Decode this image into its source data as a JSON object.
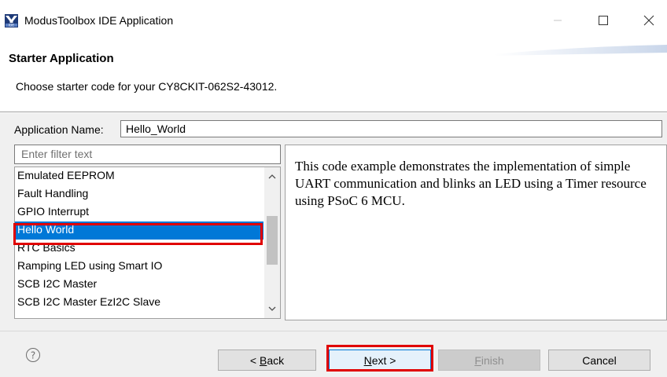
{
  "window": {
    "title": "ModusToolbox IDE Application",
    "icon": "ide-app-icon",
    "controls": [
      "minimize-icon",
      "maximize-icon",
      "close-icon"
    ]
  },
  "header": {
    "title": "Starter Application",
    "subtitle": "Choose starter code for your CY8CKIT-062S2-43012."
  },
  "form": {
    "app_name_label": "Application Name:",
    "app_name_value": "Hello_World",
    "filter_placeholder": "Enter filter text"
  },
  "list": {
    "items": [
      {
        "label": "Emulated EEPROM",
        "selected": false
      },
      {
        "label": "Fault Handling",
        "selected": false
      },
      {
        "label": "GPIO Interrupt",
        "selected": false
      },
      {
        "label": "Hello World",
        "selected": true
      },
      {
        "label": "RTC Basics",
        "selected": false
      },
      {
        "label": "Ramping LED using Smart IO",
        "selected": false
      },
      {
        "label": "SCB I2C Master",
        "selected": false
      },
      {
        "label": "SCB I2C Master EzI2C Slave",
        "selected": false
      }
    ]
  },
  "description": "This code example demonstrates the implementation of simple UART communication and blinks an LED using a Timer resource using PSoC 6 MCU.",
  "buttons": {
    "help_icon": "question-mark-icon",
    "back_prefix": "< ",
    "back_mnemonic": "B",
    "back_rest": "ack",
    "next_mnemonic": "N",
    "next_rest": "ext >",
    "finish_mnemonic": "F",
    "finish_rest": "inish",
    "cancel": "Cancel"
  },
  "colors": {
    "selection": "#0078d7",
    "highlight_annotation": "#e00000",
    "disabled_text": "#8f8f8f"
  }
}
